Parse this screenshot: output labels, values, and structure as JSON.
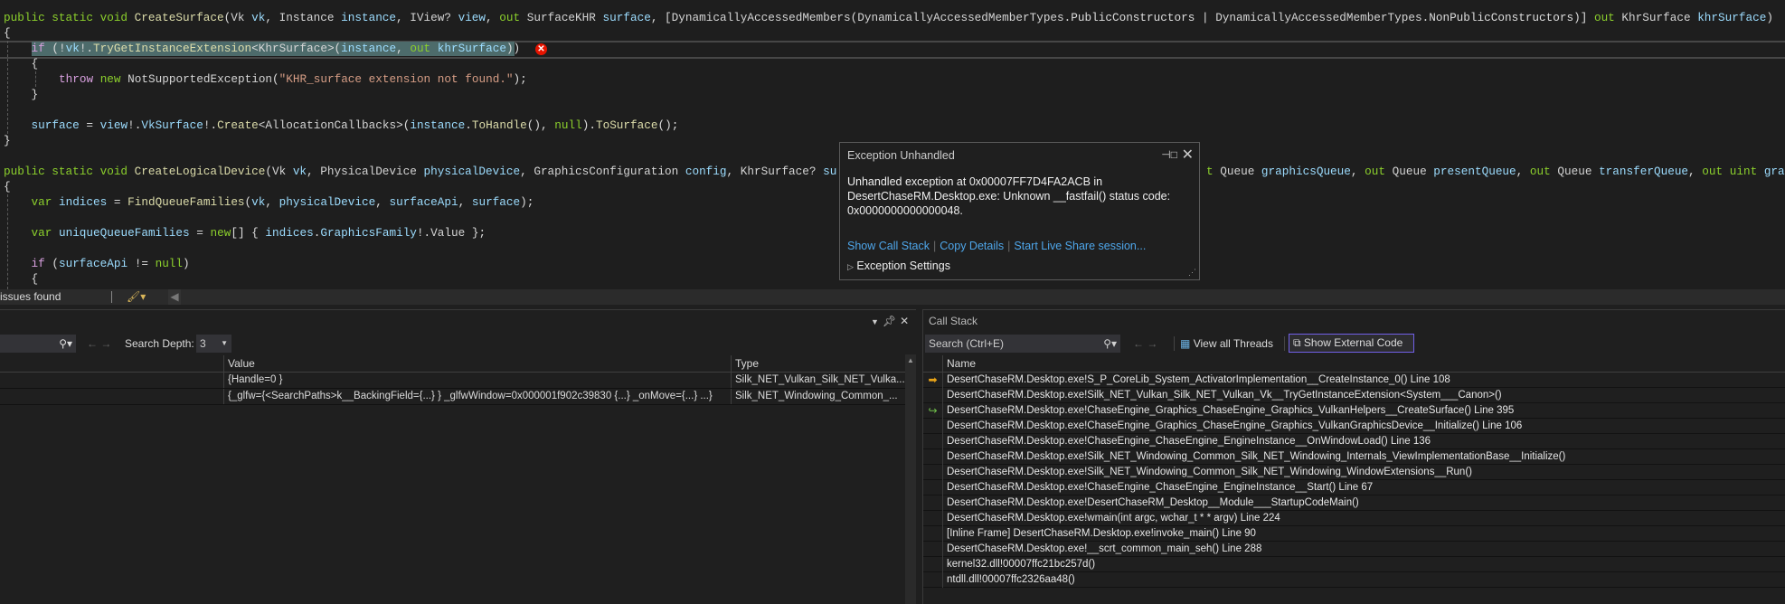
{
  "editor": {
    "lines": [
      {
        "indent": 0,
        "tokens": [
          [
            "k",
            "public static void "
          ],
          [
            "m",
            "CreateSurface"
          ],
          [
            "x",
            "("
          ],
          [
            "t",
            "Vk "
          ],
          [
            "p",
            "vk"
          ],
          [
            "x",
            ", "
          ],
          [
            "t",
            "Instance "
          ],
          [
            "p",
            "instance"
          ],
          [
            "x",
            ", "
          ],
          [
            "t",
            "IView? "
          ],
          [
            "p",
            "view"
          ],
          [
            "x",
            ", "
          ],
          [
            "k",
            "out "
          ],
          [
            "t",
            "SurfaceKHR "
          ],
          [
            "p",
            "surface"
          ],
          [
            "x",
            ", ["
          ],
          [
            "t",
            "DynamicallyAccessedMembers"
          ],
          [
            "x",
            "("
          ],
          [
            "t",
            "DynamicallyAccessedMemberTypes"
          ],
          [
            "x",
            ".PublicConstructors | "
          ],
          [
            "t",
            "DynamicallyAccessedMemberTypes"
          ],
          [
            "x",
            ".NonPublicConstructors)] "
          ],
          [
            "k",
            "out "
          ],
          [
            "t",
            "KhrSurface "
          ],
          [
            "p",
            "khrSurface"
          ],
          [
            "x",
            ")"
          ]
        ]
      },
      {
        "indent": 0,
        "tokens": [
          [
            "x",
            "{"
          ]
        ]
      },
      {
        "indent": 1,
        "tokens": [
          [
            "c",
            "if"
          ],
          [
            "x",
            " (!"
          ],
          [
            "p",
            "vk"
          ],
          [
            "x",
            "!."
          ],
          [
            "m",
            "TryGetInstanceExtension"
          ],
          [
            "x",
            "<"
          ],
          [
            "t",
            "KhrSurface"
          ],
          [
            "x",
            ">("
          ],
          [
            "p",
            "instance"
          ],
          [
            "x",
            ", "
          ],
          [
            "k",
            "out "
          ],
          [
            "p",
            "khrSurface"
          ],
          [
            "x",
            "))"
          ]
        ]
      },
      {
        "indent": 1,
        "tokens": [
          [
            "x",
            "{"
          ]
        ]
      },
      {
        "indent": 2,
        "tokens": [
          [
            "c",
            "throw "
          ],
          [
            "k",
            "new "
          ],
          [
            "t",
            "NotSupportedException"
          ],
          [
            "x",
            "("
          ],
          [
            "s",
            "\"KHR_surface extension not found.\""
          ],
          [
            "x",
            ");"
          ]
        ]
      },
      {
        "indent": 1,
        "tokens": [
          [
            "x",
            "}"
          ]
        ]
      },
      {
        "indent": 0,
        "tokens": []
      },
      {
        "indent": 1,
        "tokens": [
          [
            "p",
            "surface"
          ],
          [
            "x",
            " = "
          ],
          [
            "p",
            "view"
          ],
          [
            "x",
            "!."
          ],
          [
            "p",
            "VkSurface"
          ],
          [
            "x",
            "!."
          ],
          [
            "m",
            "Create"
          ],
          [
            "x",
            "<"
          ],
          [
            "t",
            "AllocationCallbacks"
          ],
          [
            "x",
            ">("
          ],
          [
            "p",
            "instance"
          ],
          [
            "x",
            "."
          ],
          [
            "m",
            "ToHandle"
          ],
          [
            "x",
            "(), "
          ],
          [
            "k",
            "null"
          ],
          [
            "x",
            ")."
          ],
          [
            "m",
            "ToSurface"
          ],
          [
            "x",
            "();"
          ]
        ]
      },
      {
        "indent": 0,
        "tokens": [
          [
            "x",
            "}"
          ]
        ]
      },
      {
        "indent": 0,
        "tokens": []
      },
      {
        "indent": 0,
        "tokens": [
          [
            "k",
            "public static void "
          ],
          [
            "m",
            "CreateLogicalDevice"
          ],
          [
            "x",
            "("
          ],
          [
            "t",
            "Vk "
          ],
          [
            "p",
            "vk"
          ],
          [
            "x",
            ", "
          ],
          [
            "t",
            "PhysicalDevice "
          ],
          [
            "p",
            "physicalDevice"
          ],
          [
            "x",
            ", "
          ],
          [
            "t",
            "GraphicsConfiguration "
          ],
          [
            "p",
            "config"
          ],
          [
            "x",
            ", "
          ],
          [
            "t",
            "KhrSurface? "
          ],
          [
            "p",
            "su"
          ]
        ]
      },
      {
        "indent": 0,
        "tokens": [
          [
            "x",
            "{"
          ]
        ]
      },
      {
        "indent": 1,
        "tokens": [
          [
            "k",
            "var "
          ],
          [
            "p",
            "indices"
          ],
          [
            "x",
            " = "
          ],
          [
            "m",
            "FindQueueFamilies"
          ],
          [
            "x",
            "("
          ],
          [
            "p",
            "vk"
          ],
          [
            "x",
            ", "
          ],
          [
            "p",
            "physicalDevice"
          ],
          [
            "x",
            ", "
          ],
          [
            "p",
            "surfaceApi"
          ],
          [
            "x",
            ", "
          ],
          [
            "p",
            "surface"
          ],
          [
            "x",
            ");"
          ]
        ]
      },
      {
        "indent": 0,
        "tokens": []
      },
      {
        "indent": 1,
        "tokens": [
          [
            "k",
            "var "
          ],
          [
            "p",
            "uniqueQueueFamilies"
          ],
          [
            "x",
            " = "
          ],
          [
            "k",
            "new"
          ],
          [
            "x",
            "[] { "
          ],
          [
            "p",
            "indices"
          ],
          [
            "x",
            "."
          ],
          [
            "p",
            "GraphicsFamily"
          ],
          [
            "x",
            "!."
          ],
          [
            "t",
            "Value"
          ],
          [
            "x",
            " };"
          ]
        ]
      },
      {
        "indent": 0,
        "tokens": []
      },
      {
        "indent": 1,
        "tokens": [
          [
            "c",
            "if"
          ],
          [
            "x",
            " ("
          ],
          [
            "p",
            "surfaceApi"
          ],
          [
            "x",
            " != "
          ],
          [
            "k",
            "null"
          ],
          [
            "x",
            ")"
          ]
        ]
      },
      {
        "indent": 1,
        "tokens": [
          [
            "x",
            "{"
          ]
        ]
      }
    ],
    "line11_tail": [
      [
        "k",
        "t "
      ],
      [
        "t",
        "Queue "
      ],
      [
        "p",
        "graphicsQueue"
      ],
      [
        "x",
        ", "
      ],
      [
        "k",
        "out "
      ],
      [
        "t",
        "Queue "
      ],
      [
        "p",
        "presentQueue"
      ],
      [
        "x",
        ", "
      ],
      [
        "k",
        "out "
      ],
      [
        "t",
        "Queue "
      ],
      [
        "p",
        "transferQueue"
      ],
      [
        "x",
        ", "
      ],
      [
        "k",
        "out uint "
      ],
      [
        "p",
        "graph"
      ]
    ],
    "error_glyph": "✕"
  },
  "exception_popup": {
    "title": "Exception Unhandled",
    "message": "Unhandled exception at 0x00007FF7D4FA2ACB in DesertChaseRM.Desktop.exe: Unknown __fastfail() status code: 0x0000000000000048.",
    "links": [
      "Show Call Stack",
      "Copy Details",
      "Start Live Share session..."
    ],
    "settings_label": "Exception Settings"
  },
  "statusbar": {
    "issues": "issues found"
  },
  "autos_panel": {
    "search_depth_label": "Search Depth:",
    "search_depth_value": "3",
    "columns": [
      "Value",
      "Type"
    ],
    "rows": [
      {
        "value": "{Handle=0 }",
        "type": "Silk_NET_Vulkan_Silk_NET_Vulka..."
      },
      {
        "value": "{_glfw={<SearchPaths>k__BackingField={...} } _glfwWindow=0x000001f902c39830 {...} _onMove={...} ...}",
        "type": "Silk_NET_Windowing_Common_..."
      }
    ]
  },
  "call_stack": {
    "title": "Call Stack",
    "search_placeholder": "Search (Ctrl+E)",
    "view_all_threads": "View all Threads",
    "show_external_code": "Show External Code",
    "column": "Name",
    "accent_color": "#7160e8",
    "frames": [
      {
        "icon": "current",
        "text": "DesertChaseRM.Desktop.exe!S_P_CoreLib_System_ActivatorImplementation__CreateInstance_0() Line 108"
      },
      {
        "icon": "",
        "text": "DesertChaseRM.Desktop.exe!Silk_NET_Vulkan_Silk_NET_Vulkan_Vk__TryGetInstanceExtension<System___Canon>()"
      },
      {
        "icon": "return",
        "text": "DesertChaseRM.Desktop.exe!ChaseEngine_Graphics_ChaseEngine_Graphics_VulkanHelpers__CreateSurface() Line 395"
      },
      {
        "icon": "",
        "text": "DesertChaseRM.Desktop.exe!ChaseEngine_Graphics_ChaseEngine_Graphics_VulkanGraphicsDevice__Initialize() Line 106"
      },
      {
        "icon": "",
        "text": "DesertChaseRM.Desktop.exe!ChaseEngine_ChaseEngine_EngineInstance__OnWindowLoad() Line 136"
      },
      {
        "icon": "",
        "text": "DesertChaseRM.Desktop.exe!Silk_NET_Windowing_Common_Silk_NET_Windowing_Internals_ViewImplementationBase__Initialize()"
      },
      {
        "icon": "",
        "text": "DesertChaseRM.Desktop.exe!Silk_NET_Windowing_Common_Silk_NET_Windowing_WindowExtensions__Run()"
      },
      {
        "icon": "",
        "text": "DesertChaseRM.Desktop.exe!ChaseEngine_ChaseEngine_EngineInstance__Start() Line 67"
      },
      {
        "icon": "",
        "text": "DesertChaseRM.Desktop.exe!DesertChaseRM_Desktop__Module___StartupCodeMain()"
      },
      {
        "icon": "",
        "text": "DesertChaseRM.Desktop.exe!wmain(int argc, wchar_t * * argv) Line 224"
      },
      {
        "icon": "",
        "text": "[Inline Frame] DesertChaseRM.Desktop.exe!invoke_main() Line 90"
      },
      {
        "icon": "",
        "text": "DesertChaseRM.Desktop.exe!__scrt_common_main_seh() Line 288"
      },
      {
        "icon": "",
        "text": "kernel32.dll!00007ffc21bc257d()"
      },
      {
        "icon": "",
        "text": "ntdll.dll!00007ffc2326aa48()"
      }
    ]
  }
}
